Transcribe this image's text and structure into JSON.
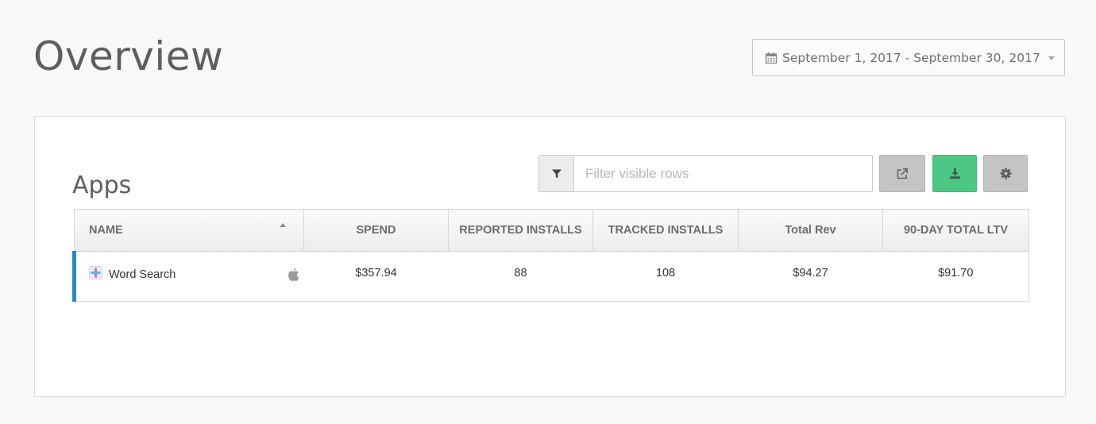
{
  "header": {
    "title": "Overview",
    "date_range": "September 1, 2017 - September 30, 2017",
    "icons": {
      "calendar": "calendar-icon",
      "dropdown": "caret-down-icon"
    }
  },
  "apps_panel": {
    "title": "Apps",
    "filter": {
      "placeholder": "Filter visible rows",
      "value": "",
      "icon": "filter-icon"
    },
    "toolbar": {
      "export_icon": "external-link-icon",
      "download_icon": "download-icon",
      "settings_icon": "gear-icon",
      "download_color": "#4dc884"
    },
    "table": {
      "columns": [
        "NAME",
        "SPEND",
        "REPORTED INSTALLS",
        "TRACKED INSTALLS",
        "Total Rev",
        "90-DAY TOTAL LTV"
      ],
      "sort": {
        "column": "NAME",
        "direction": "ascending"
      },
      "rows": [
        {
          "name": "Word Search",
          "platform": "apple-icon",
          "spend": "$357.94",
          "reported_installs": "88",
          "tracked_installs": "108",
          "total_rev": "$94.27",
          "ltv_90_day": "$91.70",
          "accent_color": "#2b88c8"
        }
      ]
    }
  }
}
